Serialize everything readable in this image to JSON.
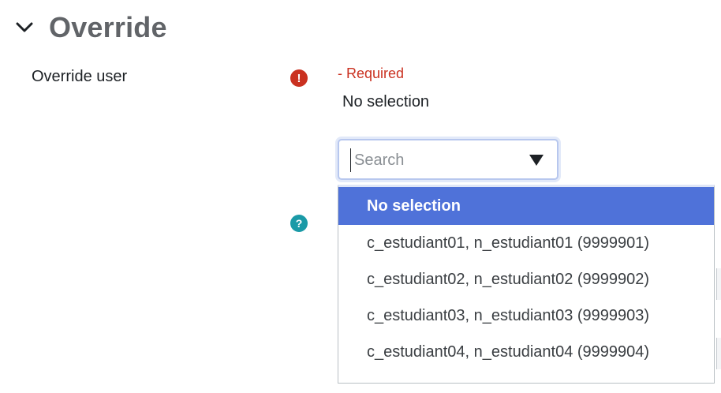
{
  "section": {
    "title": "Override",
    "toggle_icon": "chevron-down-icon"
  },
  "field": {
    "label": "Override user",
    "required_icon": "exclamation-icon",
    "required_icon_glyph": "!",
    "required_text": "- Required",
    "current_value": "No selection"
  },
  "search": {
    "placeholder": "Search",
    "value": "",
    "dropdown_icon": "triangle-down-icon"
  },
  "help": {
    "icon": "question-icon",
    "glyph": "?"
  },
  "dropdown": {
    "options": [
      {
        "label": "No selection",
        "selected": true
      },
      {
        "label": "c_estudiant01, n_estudiant01 (9999901)",
        "selected": false
      },
      {
        "label": "c_estudiant02, n_estudiant02 (9999902)",
        "selected": false
      },
      {
        "label": "c_estudiant03, n_estudiant03 (9999903)",
        "selected": false
      },
      {
        "label": "c_estudiant04, n_estudiant04 (9999904)",
        "selected": false
      }
    ]
  },
  "colors": {
    "title": "#616468",
    "required": "#ca3120",
    "help": "#1a9aa7",
    "selected_option": "#4f72d9"
  }
}
